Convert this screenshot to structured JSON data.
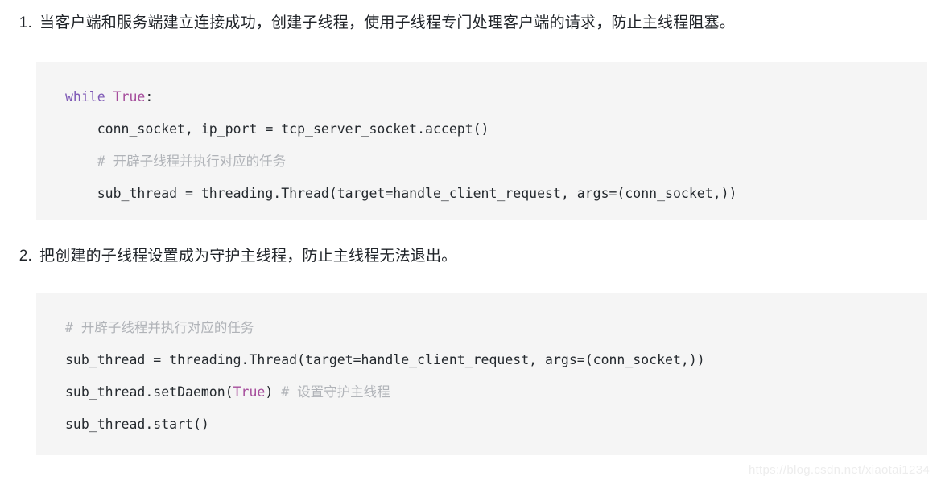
{
  "document": {
    "items": [
      {
        "marker": "1.",
        "text": "当客户端和服务端建立连接成功，创建子线程，使用子线程专门处理客户端的请求，防止主线程阻塞。"
      },
      {
        "marker": "2.",
        "text": "把创建的子线程设置成为守护主线程，防止主线程无法退出。"
      }
    ],
    "code_blocks": [
      {
        "id": "code-block-1",
        "language": "python",
        "lines": [
          [
            {
              "type": "keyword",
              "text": "while"
            },
            {
              "type": "plain",
              "text": " "
            },
            {
              "type": "constant",
              "text": "True"
            },
            {
              "type": "plain",
              "text": ":"
            }
          ],
          [
            {
              "type": "plain",
              "text": "    conn_socket, ip_port = tcp_server_socket.accept()"
            }
          ],
          [
            {
              "type": "plain",
              "text": "    "
            },
            {
              "type": "comment",
              "text": "# 开辟子线程并执行对应的任务"
            }
          ],
          [
            {
              "type": "plain",
              "text": "    sub_thread = threading.Thread(target=handle_client_request, args=(conn_socket,))"
            }
          ]
        ]
      },
      {
        "id": "code-block-2",
        "language": "python",
        "lines": [
          [
            {
              "type": "comment",
              "text": "# 开辟子线程并执行对应的任务"
            }
          ],
          [
            {
              "type": "plain",
              "text": "sub_thread = threading.Thread(target=handle_client_request, args=(conn_socket,))"
            }
          ],
          [
            {
              "type": "plain",
              "text": "sub_thread.setDaemon("
            },
            {
              "type": "constant",
              "text": "True"
            },
            {
              "type": "plain",
              "text": ") "
            },
            {
              "type": "comment",
              "text": "# 设置守护主线程"
            }
          ],
          [
            {
              "type": "plain",
              "text": "sub_thread.start()"
            }
          ]
        ]
      }
    ],
    "watermark": "https://blog.csdn.net/xiaotai1234",
    "colors": {
      "text": "#1f2328",
      "code_background": "#f5f5f5",
      "code_text": "#24292e",
      "keyword": "#7f5ab6",
      "constant": "#a54c9b",
      "comment": "#b0b3b8",
      "watermark": "#ededed",
      "page_background": "#ffffff"
    }
  }
}
